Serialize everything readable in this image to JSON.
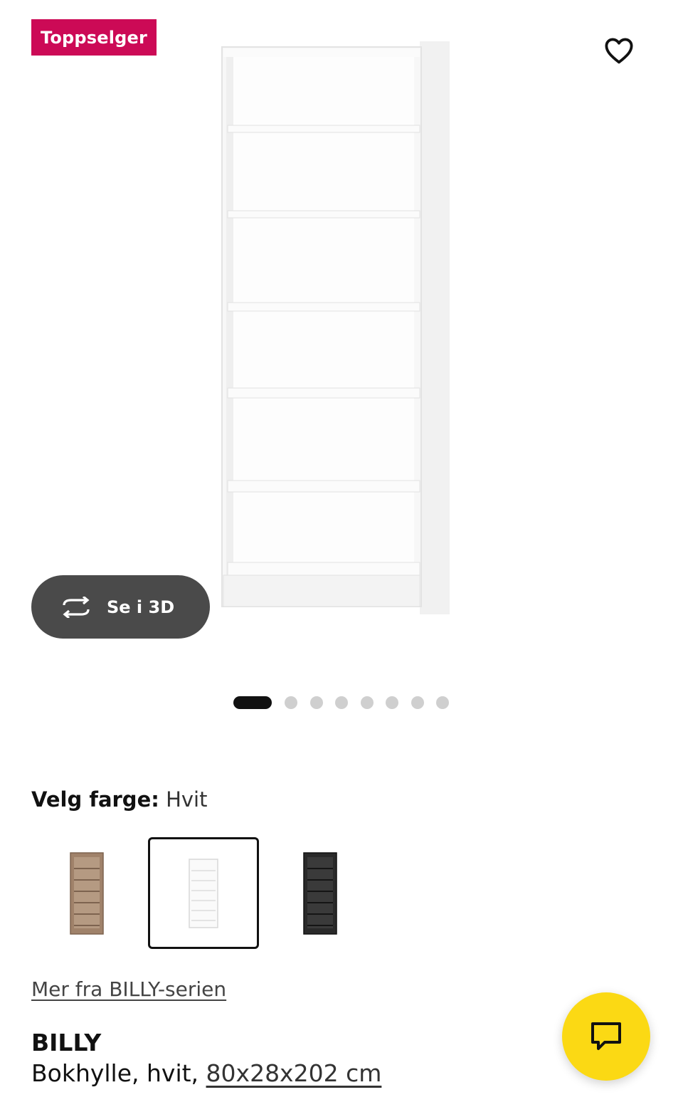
{
  "badge": {
    "label": "Toppselger",
    "color": "#cc0a56"
  },
  "gallery": {
    "view_3d_label": "Se i 3D",
    "dot_count": 8,
    "active_dot": 0
  },
  "color_picker": {
    "label": "Velg farge:",
    "selected_value": "Hvit",
    "options": [
      {
        "name": "wood-effect",
        "color": "#a0826a",
        "selected": false
      },
      {
        "name": "white",
        "color": "#ffffff",
        "selected": true
      },
      {
        "name": "black",
        "color": "#2a2a2a",
        "selected": false
      }
    ]
  },
  "series_link": "Mer fra BILLY-serien",
  "product": {
    "name": "BILLY",
    "description_prefix": "Bokhylle, hvit, ",
    "dimensions": "80x28x202 cm"
  },
  "colors": {
    "chat_button": "#fbd914",
    "dark_button": "#4a4a4a"
  }
}
